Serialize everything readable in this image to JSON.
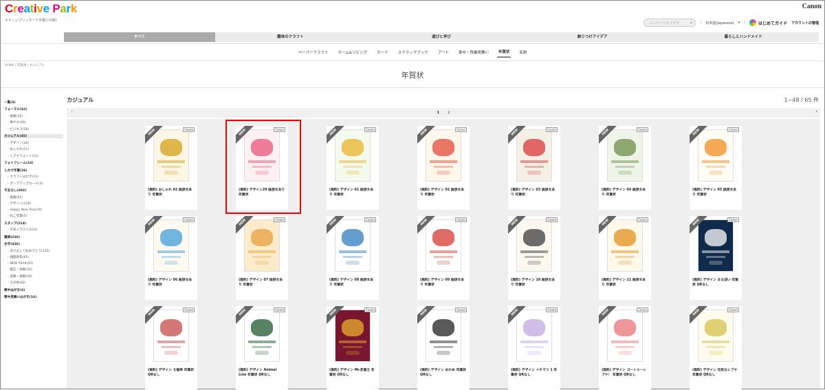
{
  "logo": {
    "parts": [
      {
        "t": "C",
        "c": "#e60012"
      },
      {
        "t": "r",
        "c": "#f39800"
      },
      {
        "t": "e",
        "c": "#e4007f"
      },
      {
        "t": "a",
        "c": "#00a0e9"
      },
      {
        "t": "t",
        "c": "#8fc31f"
      },
      {
        "t": "i",
        "c": "#e60012"
      },
      {
        "t": "v",
        "c": "#f39800"
      },
      {
        "t": "e",
        "c": "#00a0e9"
      },
      {
        "t": " ",
        "c": "#000"
      },
      {
        "t": "P",
        "c": "#e4007f"
      },
      {
        "t": "a",
        "c": "#8fc31f"
      },
      {
        "t": "r",
        "c": "#00a0e9"
      },
      {
        "t": "k",
        "c": "#f39800"
      }
    ]
  },
  "tagline": "キヤノンプリンターで手軽に印刷！",
  "brand": "Canon",
  "search": {
    "placeholder": "コンテンツをさがす"
  },
  "language": "日本語(Japanese)",
  "guide": "はじめてガイド",
  "account": "アカウントの管理",
  "main_nav": [
    {
      "label": "すべて",
      "active": true
    },
    {
      "label": "趣味のクラフト",
      "active": false
    },
    {
      "label": "遊びと学び",
      "active": false
    },
    {
      "label": "飾りつけアイデア",
      "active": false
    },
    {
      "label": "暮らしとハンドメイド",
      "active": false
    }
  ],
  "sub_nav": [
    {
      "label": "ペーパークラフト",
      "active": false
    },
    {
      "label": "ホーム&リビング",
      "active": false
    },
    {
      "label": "カード",
      "active": false
    },
    {
      "label": "スクラップブック",
      "active": false
    },
    {
      "label": "アート",
      "active": false
    },
    {
      "label": "喪中・残暑見舞い",
      "active": false
    },
    {
      "label": "年賀状",
      "active": true
    },
    {
      "label": "名刺",
      "active": false
    }
  ],
  "breadcrumb": "HOME / 年賀状 / カジュアル",
  "page_title": "年賀状",
  "sidebar": [
    {
      "label": "一覧(3)",
      "type": "grp"
    },
    {
      "label": "フォーマル(62)",
      "type": "grp"
    },
    {
      "label": "金銀(32)",
      "type": "sub"
    },
    {
      "label": "華やか(30)",
      "type": "sub"
    },
    {
      "label": "ビジネス(18)",
      "type": "sub"
    },
    {
      "label": "カジュアル(45)",
      "type": "grp",
      "active": true
    },
    {
      "label": "デザイン(30)",
      "type": "sub"
    },
    {
      "label": "おしゃれ(11)",
      "type": "sub"
    },
    {
      "label": "シブヤフォント(14)",
      "type": "sub"
    },
    {
      "label": "フォトフレーム(16)",
      "type": "grp"
    },
    {
      "label": "しかけ年賀(26)",
      "type": "grp"
    },
    {
      "label": "クラフトはがき(23)",
      "type": "sub"
    },
    {
      "label": "ポップアップカード(3)",
      "type": "sub"
    },
    {
      "label": "干支なし(202)",
      "type": "grp"
    },
    {
      "label": "金銀(61)",
      "type": "sub"
    },
    {
      "label": "デザイン(126)",
      "type": "sub"
    },
    {
      "label": "Happy New Year(10)",
      "type": "sub"
    },
    {
      "label": "ねこ年賀(5)",
      "type": "sub"
    },
    {
      "label": "スタンプ(214)",
      "type": "grp"
    },
    {
      "label": "干支イラスト(214)",
      "type": "sub"
    },
    {
      "label": "賀詞(236)",
      "type": "grp"
    },
    {
      "label": "文字(436)",
      "type": "grp"
    },
    {
      "label": "あけましておめでとう(125)",
      "type": "sub"
    },
    {
      "label": "謹賀新年(65)",
      "type": "sub"
    },
    {
      "label": "NEW YEAR(55)",
      "type": "sub"
    },
    {
      "label": "賀正・頌春(55)",
      "type": "sub"
    },
    {
      "label": "迎春・頌歌(54)",
      "type": "sub"
    },
    {
      "label": "その他(82)",
      "type": "sub"
    },
    {
      "label": "寒中はがき(6)",
      "type": "grp"
    },
    {
      "label": "寒中見舞いはがき(16)",
      "type": "grp"
    }
  ],
  "section_title": "カジュアル",
  "result_count": "1~48 / 65 件",
  "pager": {
    "prev": "‹",
    "next": "›",
    "pages": [
      {
        "label": "1",
        "active": true
      },
      {
        "label": "2",
        "active": false
      }
    ]
  },
  "badge_new": "NEW",
  "badge_canon": "Canon",
  "cards": [
    {
      "caption": "(無料) おしゃれ 02 挨拶文あり 年賀状",
      "bg": "#fdf5e6",
      "accent": "#d4a017"
    },
    {
      "caption": "(無料) デザイン29 挨拶文あり 年賀状",
      "bg": "#fff0f4",
      "accent": "#e8557a"
    },
    {
      "caption": "(無料) デザイン 01 挨拶文あり 年賀状",
      "bg": "#f4fbee",
      "accent": "#e9b42a"
    },
    {
      "caption": "(無料) デザイン 02 挨拶文あり 年賀状",
      "bg": "#fff7ea",
      "accent": "#e14b3b"
    },
    {
      "caption": "(無料) デザイン 03 挨拶文あり 年賀状",
      "bg": "#f5f0e6",
      "accent": "#d83a3a"
    },
    {
      "caption": "(無料) デザイン 04 挨拶文あり 年賀状",
      "bg": "#eef4e8",
      "accent": "#6f8d4a"
    },
    {
      "caption": "(無料) デザイン 05 挨拶文あり 年賀状",
      "bg": "#fffdf5",
      "accent": "#f28c1e"
    },
    {
      "caption": "(無料) デザイン 06 挨拶文あり 年賀状",
      "bg": "#fffaf0",
      "accent": "#3f9ed8"
    },
    {
      "caption": "(無料) デザイン 07 挨拶文あり 年賀状",
      "bg": "#fdeccb",
      "accent": "#e6a23c"
    },
    {
      "caption": "(無料) デザイン 08 挨拶文あり 年賀状",
      "bg": "#fff",
      "accent": "#2e7fc0"
    },
    {
      "caption": "(無料) デザイン 09 挨拶文あり 年賀状",
      "bg": "#fff",
      "accent": "#d73b32"
    },
    {
      "caption": "(無料) デザイン 10 挨拶文あり 年賀状",
      "bg": "#fdf8ef",
      "accent": "#3c3c3c"
    },
    {
      "caption": "(無料) デザイン 11 挨拶文あり 年賀状",
      "bg": "#fff9ec",
      "accent": "#e28f1c"
    },
    {
      "caption": "(無料) デザイン まる迎い 年賀状 QRなし",
      "bg": "#0f2a4a",
      "accent": "#ffffff"
    },
    {
      "caption": "(無料) デザイン 七福神 年賀状 QRなし",
      "bg": "#fff",
      "accent": "#c44a4a"
    },
    {
      "caption": "(無料) デザイン Animal Line 年賀状 QRなし",
      "bg": "#fff",
      "accent": "#1f5a2e"
    },
    {
      "caption": "(無料) デザイン Mr.赤富士 年賀状 QRなし",
      "bg": "#7a1530",
      "accent": "#e8b02b"
    },
    {
      "caption": "(無料) デザイン おかめ 年賀状 QRなし",
      "bg": "#fff",
      "accent": "#222222"
    },
    {
      "caption": "(無料) デザイン イチマツ 1 年賀状 QRなし",
      "bg": "#fff",
      "accent": "#c0a8e0"
    },
    {
      "caption": "(無料) デザイン ゴートゥーシブヤ！ 年賀状 QRなし",
      "bg": "#fff",
      "accent": "#e8747a"
    },
    {
      "caption": "(無料) デザイン 元気なシブヤ 年賀状 QRなし",
      "bg": "#fffbee",
      "accent": "#d4c24a"
    }
  ]
}
